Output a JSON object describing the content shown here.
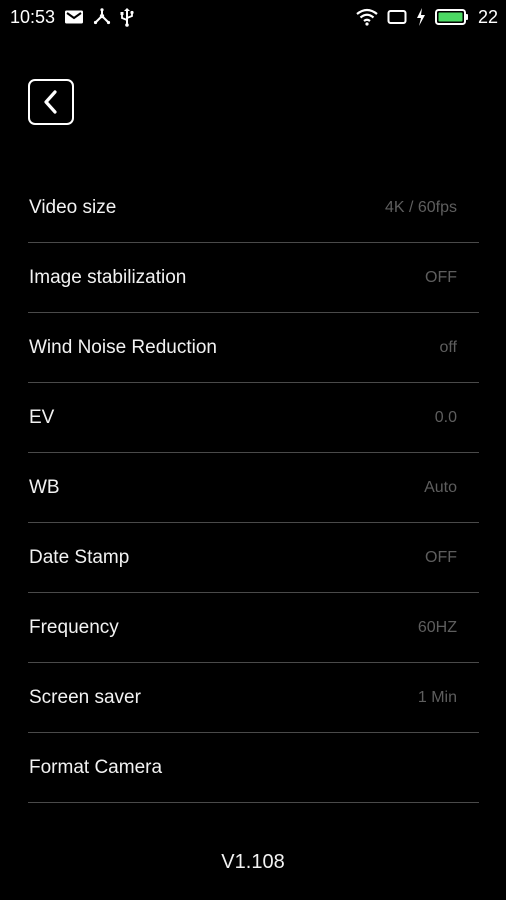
{
  "status_bar": {
    "time": "10:53",
    "battery_level": "22",
    "icons": [
      "mail-icon",
      "network-share-icon",
      "usb-icon",
      "wifi-icon",
      "screen-cast-icon",
      "charging-icon",
      "battery-icon"
    ],
    "battery_color": "#4cd964"
  },
  "header": {
    "back_icon": "chevron-left-icon"
  },
  "settings": [
    {
      "label": "Video size",
      "value": "4K / 60fps"
    },
    {
      "label": "Image stabilization",
      "value": "OFF"
    },
    {
      "label": "Wind Noise Reduction",
      "value": "off"
    },
    {
      "label": "EV",
      "value": "0.0"
    },
    {
      "label": "WB",
      "value": "Auto"
    },
    {
      "label": "Date Stamp",
      "value": "OFF"
    },
    {
      "label": "Frequency",
      "value": "60HZ"
    },
    {
      "label": "Screen saver",
      "value": "1 Min"
    },
    {
      "label": "Format Camera",
      "value": ""
    }
  ],
  "footer": {
    "version": "V1.108"
  },
  "colors": {
    "background": "#000000",
    "label": "#f2f2f2",
    "value": "#5e5e5e",
    "divider": "#4a4a4a"
  }
}
